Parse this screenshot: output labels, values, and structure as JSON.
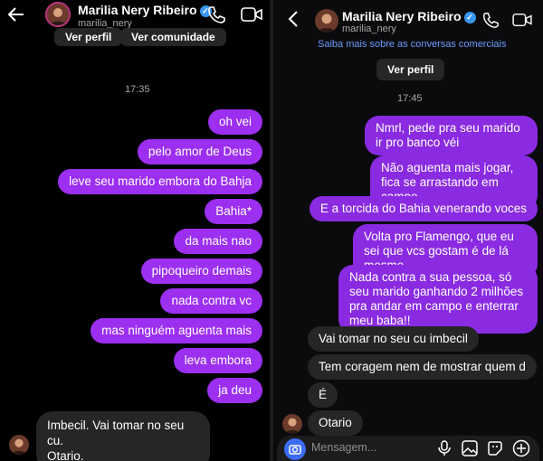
{
  "left": {
    "title": "Marilia Nery Ribeiro",
    "handle": "marilia_nery",
    "buttons": [
      "Ver perfil",
      "Ver comunidade"
    ],
    "timestamp": "17:35",
    "sent": [
      "oh vei",
      "pelo amor de Deus",
      "leve seu marido embora do Bahja",
      "Bahia*",
      "da mais nao",
      "pipoqueiro demais",
      "nada contra vc",
      "mas ninguém aguenta mais",
      "leva embora",
      "ja deu"
    ],
    "received": "Imbecil. Vai tomar no seu cu.\nOtario."
  },
  "right": {
    "title": "Marilia Nery Ribeiro",
    "handle": "marilia_nery",
    "business_link": "Saiba mais sobre as conversas comerciais",
    "profile_button": "Ver perfil",
    "timestamp": "17:45",
    "sent": [
      "Nmrl, pede pra seu marido ir pro banco véi",
      "Não aguenta mais jogar, fica se arrastando em campo",
      "E a torcida do Bahia venerando voces",
      "Volta pro Flamengo, que eu sei que vcs gostam é de lá mesmo",
      "Nada contra a sua pessoa, só seu marido ganhando 2 milhões pra andar em campo e enterrar meu baba!!"
    ],
    "received": [
      "Vai tomar no seu cu imbecil",
      "Tem coragem nem de mostrar quem d",
      "É",
      "Otario"
    ],
    "composer_placeholder": "Mensagem..."
  },
  "icons": {
    "back": "back-arrow-icon",
    "call": "phone-icon",
    "video": "video-camera-icon",
    "verified": "verified-badge-icon",
    "camera": "camera-icon",
    "mic": "microphone-icon",
    "gallery": "gallery-icon",
    "sticker": "sticker-icon",
    "add": "plus-icon"
  },
  "colors": {
    "bubble_sent": "#8a2be2",
    "bubble_received": "#262626",
    "verified": "#3897f0"
  }
}
